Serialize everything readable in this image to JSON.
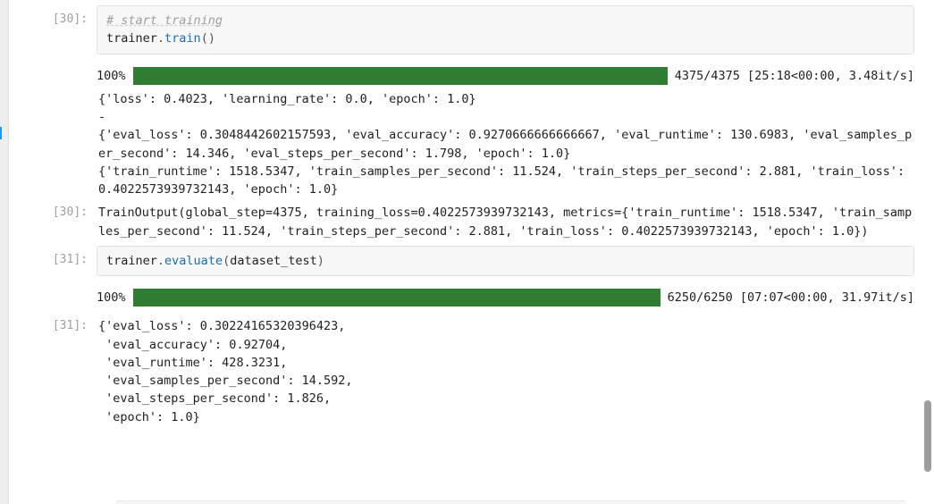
{
  "cells": {
    "c30_code": {
      "prompt": "[30]:",
      "comment": "# start training",
      "line2_ident": "trainer",
      "line2_call": "train",
      "line2_paren": "()"
    },
    "c30_progress": {
      "percent": "100%",
      "right": "4375/4375 [25:18<00:00,   3.48it/s]"
    },
    "c30_out_text": "{'loss': 0.4023, 'learning_rate': 0.0, 'epoch': 1.0}\n-\n{'eval_loss': 0.3048442602157593, 'eval_accuracy': 0.9270666666666667, 'eval_runtime': 130.6983, 'eval_samples_per_second': 14.346, 'eval_steps_per_second': 1.798, 'epoch': 1.0}\n{'train_runtime': 1518.5347, 'train_samples_per_second': 11.524, 'train_steps_per_second': 2.881, 'train_loss': 0.4022573939732143, 'epoch': 1.0}",
    "c30_result": {
      "prompt": "[30]:",
      "text": "TrainOutput(global_step=4375, training_loss=0.4022573939732143, metrics={'train_runtime': 1518.5347, 'train_samples_per_second': 11.524, 'train_steps_per_second': 2.881, 'train_loss': 0.4022573939732143, 'epoch': 1.0})"
    },
    "c31_code": {
      "prompt": "[31]:",
      "ident": "trainer",
      "call": "evaluate",
      "arg": "dataset_test"
    },
    "c31_progress": {
      "percent": "100%",
      "right": "6250/6250 [07:07<00:00, 31.97it/s]"
    },
    "c31_result": {
      "prompt": "[31]:",
      "text": "{'eval_loss': 0.30224165320396423,\n 'eval_accuracy': 0.92704,\n 'eval_runtime': 428.3231,\n 'eval_samples_per_second': 14.592,\n 'eval_steps_per_second': 1.826,\n 'epoch': 1.0}"
    }
  }
}
